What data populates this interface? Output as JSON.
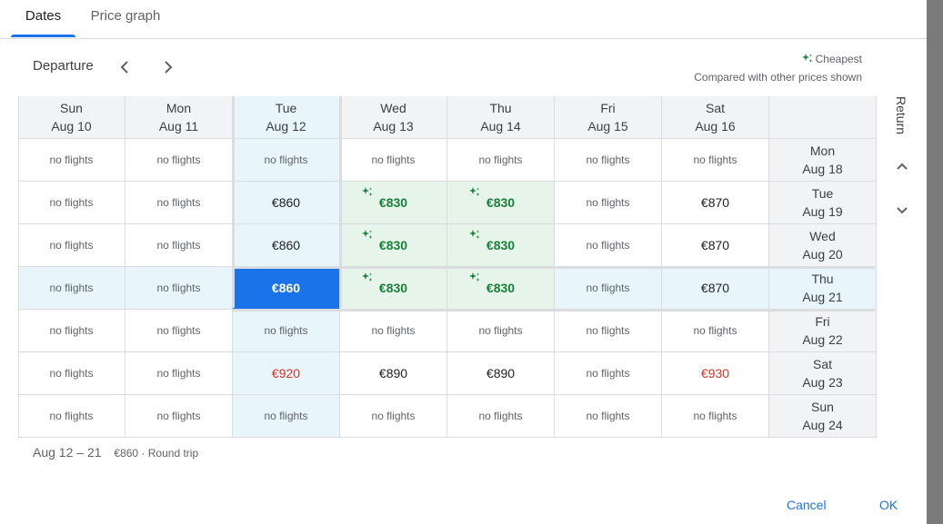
{
  "tabs": [
    {
      "label": "Dates",
      "active": true
    },
    {
      "label": "Price graph",
      "active": false
    }
  ],
  "departure_label": "Departure",
  "return_label": "Return",
  "legend": {
    "cheapest": "Cheapest",
    "note": "Compared with other prices shown",
    "icon": "sparkle-icon",
    "color": "#188038"
  },
  "departure_days": [
    {
      "day": "Sun",
      "date": "Aug 10"
    },
    {
      "day": "Mon",
      "date": "Aug 11"
    },
    {
      "day": "Tue",
      "date": "Aug 12"
    },
    {
      "day": "Wed",
      "date": "Aug 13"
    },
    {
      "day": "Thu",
      "date": "Aug 14"
    },
    {
      "day": "Fri",
      "date": "Aug 15"
    },
    {
      "day": "Sat",
      "date": "Aug 16"
    }
  ],
  "return_days": [
    {
      "day": "Mon",
      "date": "Aug 18"
    },
    {
      "day": "Tue",
      "date": "Aug 19"
    },
    {
      "day": "Wed",
      "date": "Aug 20"
    },
    {
      "day": "Thu",
      "date": "Aug 21"
    },
    {
      "day": "Fri",
      "date": "Aug 22"
    },
    {
      "day": "Sat",
      "date": "Aug 23"
    },
    {
      "day": "Sun",
      "date": "Aug 24"
    }
  ],
  "grid": [
    [
      "no flights",
      "no flights",
      "no flights",
      "no flights",
      "no flights",
      "no flights",
      "no flights"
    ],
    [
      "no flights",
      "no flights",
      "€860",
      "€830",
      "€830",
      "no flights",
      "€870"
    ],
    [
      "no flights",
      "no flights",
      "€860",
      "€830",
      "€830",
      "no flights",
      "€870"
    ],
    [
      "no flights",
      "no flights",
      "€860",
      "€830",
      "€830",
      "no flights",
      "€870"
    ],
    [
      "no flights",
      "no flights",
      "no flights",
      "no flights",
      "no flights",
      "no flights",
      "no flights"
    ],
    [
      "no flights",
      "no flights",
      "€920",
      "€890",
      "€890",
      "no flights",
      "€930"
    ],
    [
      "no flights",
      "no flights",
      "no flights",
      "no flights",
      "no flights",
      "no flights",
      "no flights"
    ]
  ],
  "cheapest_cells": [
    [
      1,
      3
    ],
    [
      1,
      4
    ],
    [
      2,
      3
    ],
    [
      2,
      4
    ],
    [
      3,
      3
    ],
    [
      3,
      4
    ]
  ],
  "expensive_cells": [
    [
      5,
      2
    ],
    [
      5,
      6
    ]
  ],
  "selected": {
    "row": 3,
    "col": 2
  },
  "colors": {
    "accent": "#1a73e8",
    "cheap": "#188038",
    "expensive": "#d93025",
    "highlight": "#e8f6fb",
    "cheap_bg": "#e6f4ea"
  },
  "summary": {
    "dates": "Aug 12 – 21",
    "detail": "€860 · Round trip"
  },
  "buttons": {
    "cancel": "Cancel",
    "ok": "OK"
  }
}
